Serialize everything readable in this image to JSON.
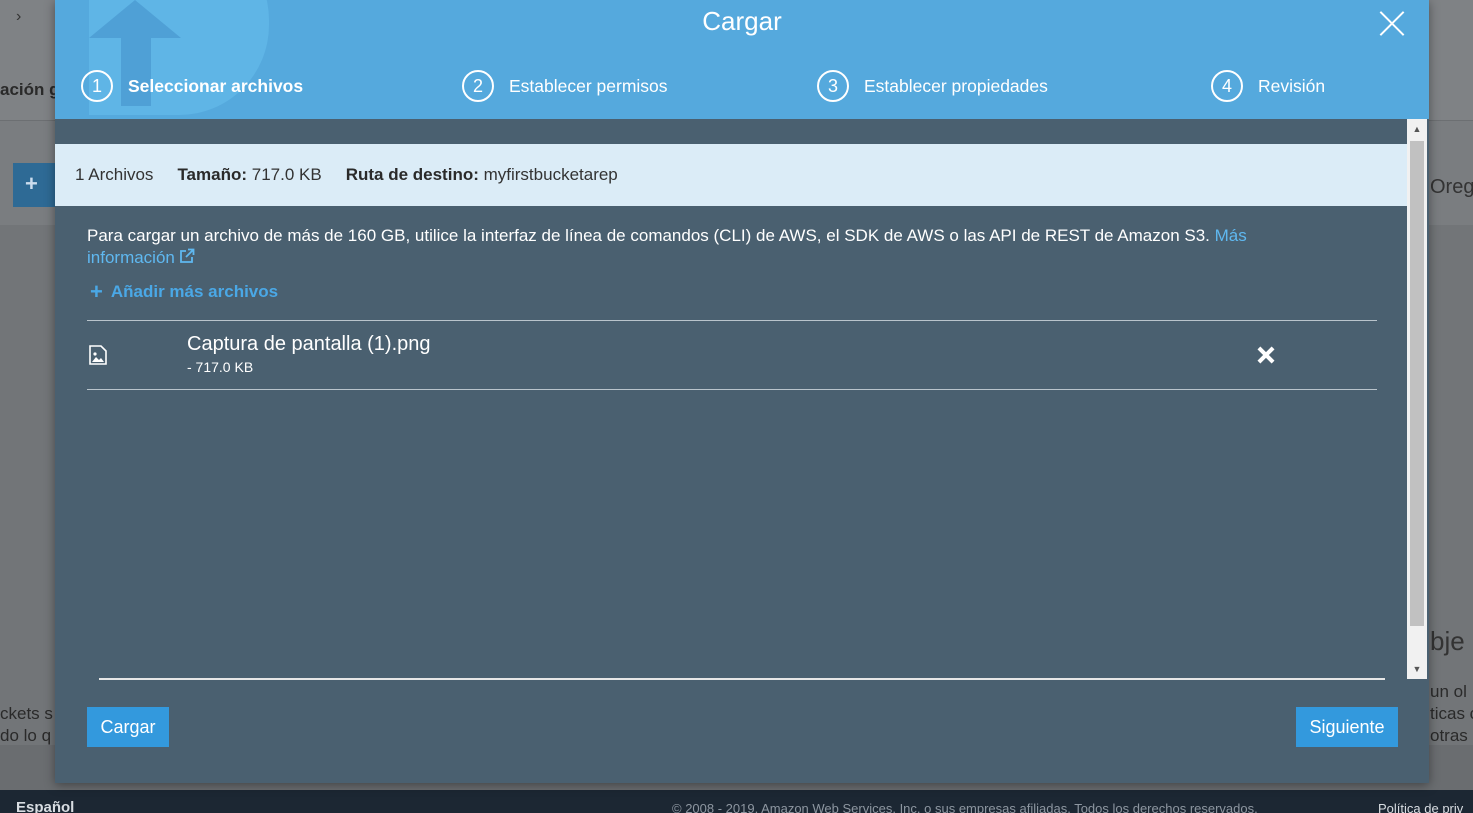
{
  "background": {
    "left_heading_fragment": "ación g",
    "right_text_fragment": "Oreg",
    "right_heading_fragment": "bje",
    "right_lines": [
      "un ol",
      "ticas c",
      "otras"
    ],
    "left_lines": [
      "ckets s",
      "do lo q"
    ],
    "add_button_label": "+",
    "footer": {
      "language": "Español",
      "copyright": "© 2008 - 2019, Amazon Web Services, Inc. o sus empresas afiliadas. Todos los derechos reservados.",
      "privacy": "Política de priv"
    }
  },
  "modal": {
    "title": "Cargar",
    "steps": [
      {
        "number": "1",
        "label": "Seleccionar archivos",
        "active": true
      },
      {
        "number": "2",
        "label": "Establecer permisos",
        "active": false
      },
      {
        "number": "3",
        "label": "Establecer propiedades",
        "active": false
      },
      {
        "number": "4",
        "label": "Revisión",
        "active": false
      }
    ],
    "info": {
      "count": "1 Archivos",
      "size_label": "Tamaño:",
      "size_value": "717.0 KB",
      "dest_label": "Ruta de destino:",
      "dest_value": "myfirstbucketarep"
    },
    "notice_text": "Para cargar un archivo de más de 160 GB, utilice la interfaz de línea de comandos (CLI) de AWS, el SDK de AWS o las API de REST de Amazon S3.",
    "notice_link": "Más información",
    "add_more_label": "Añadir más archivos",
    "files": [
      {
        "name": "Captura de pantalla (1).png",
        "size": "- 717.0 KB"
      }
    ],
    "buttons": {
      "upload": "Cargar",
      "next": "Siguiente"
    }
  },
  "colors": {
    "header_blue": "#55a9dd",
    "body_slate": "#4a6070",
    "info_bar": "#dbecf7",
    "link_blue": "#5fb8f0",
    "button_blue": "#3399dd"
  },
  "icons": {
    "close": "close-icon",
    "file": "image-file-icon",
    "remove": "remove-icon",
    "external": "external-link-icon",
    "plus": "plus-icon"
  }
}
